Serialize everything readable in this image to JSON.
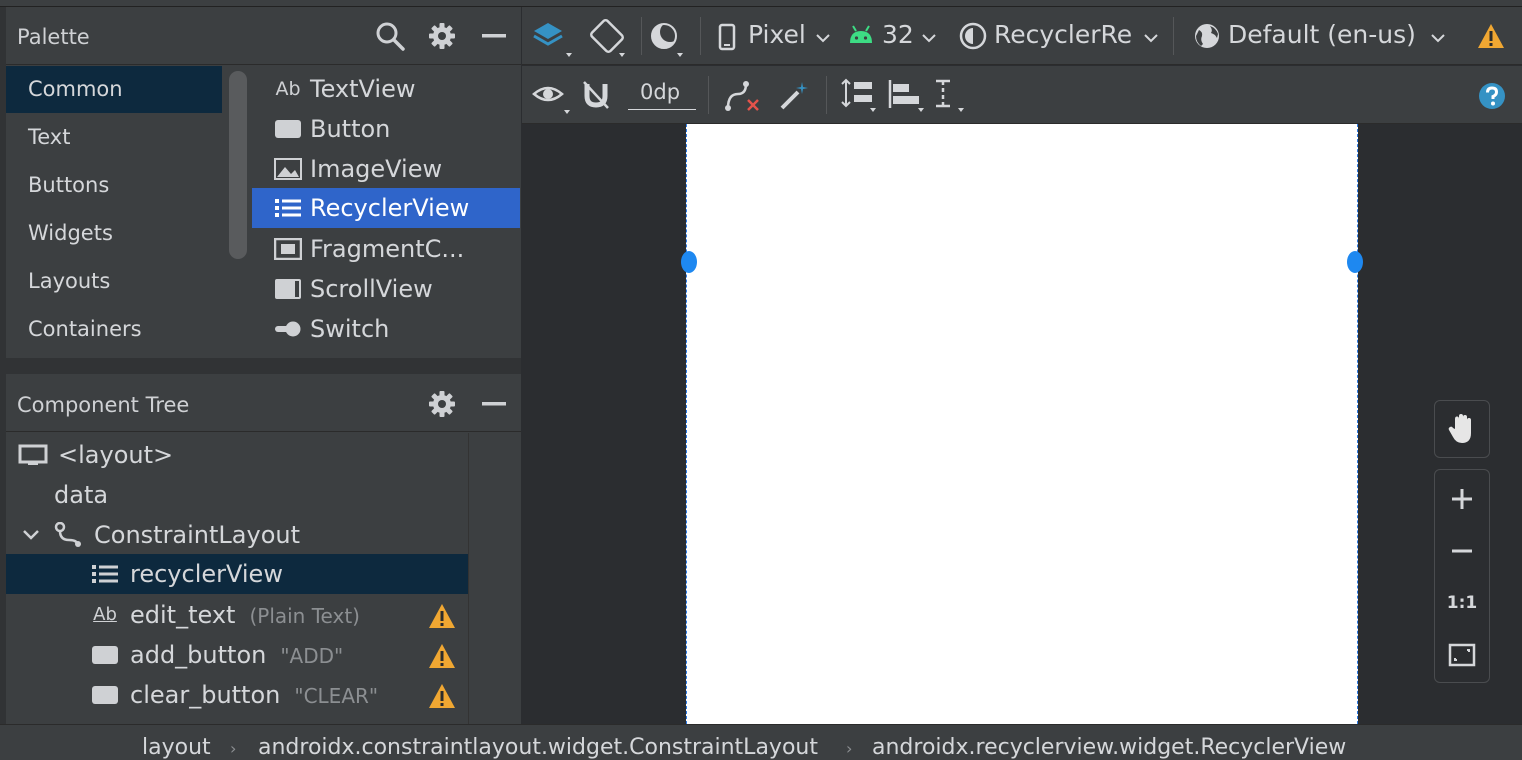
{
  "palette": {
    "title": "Palette",
    "categories": [
      "Common",
      "Text",
      "Buttons",
      "Widgets",
      "Layouts",
      "Containers"
    ],
    "widgets": [
      {
        "label": "TextView",
        "icon": "textview-icon",
        "icon_text": "Ab"
      },
      {
        "label": "Button",
        "icon": "button-icon"
      },
      {
        "label": "ImageView",
        "icon": "image-icon"
      },
      {
        "label": "RecyclerView",
        "icon": "list-icon"
      },
      {
        "label": "FragmentC...",
        "icon": "fragment-icon"
      },
      {
        "label": "ScrollView",
        "icon": "scrollview-icon"
      },
      {
        "label": "Switch",
        "icon": "switch-icon"
      }
    ]
  },
  "component_tree": {
    "title": "Component Tree",
    "items": [
      {
        "label": "<layout>",
        "hint": ""
      },
      {
        "label": "data",
        "hint": ""
      },
      {
        "label": "ConstraintLayout",
        "hint": ""
      },
      {
        "label": "recyclerView",
        "hint": ""
      },
      {
        "label": "edit_text",
        "hint": "(Plain Text)"
      },
      {
        "label": "add_button",
        "hint": "\"ADD\""
      },
      {
        "label": "clear_button",
        "hint": "\"CLEAR\""
      }
    ],
    "textview_icon_text": "Ab"
  },
  "toolbar": {
    "device": "Pixel",
    "api_level": "32",
    "theme": "RecyclerRe",
    "locale": "Default (en-us)",
    "margin": "0dp"
  },
  "zoom": {
    "actual_size": "1:1"
  },
  "breadcrumb": {
    "items": [
      "layout",
      "androidx.constraintlayout.widget.ConstraintLayout",
      "androidx.recyclerview.widget.RecyclerView"
    ]
  },
  "colors": {
    "accent": "#2f65ca",
    "warning": "#f0a732",
    "android_green": "#3ddc84",
    "help_blue": "#3592c4",
    "handle_blue": "#1e88f0"
  }
}
